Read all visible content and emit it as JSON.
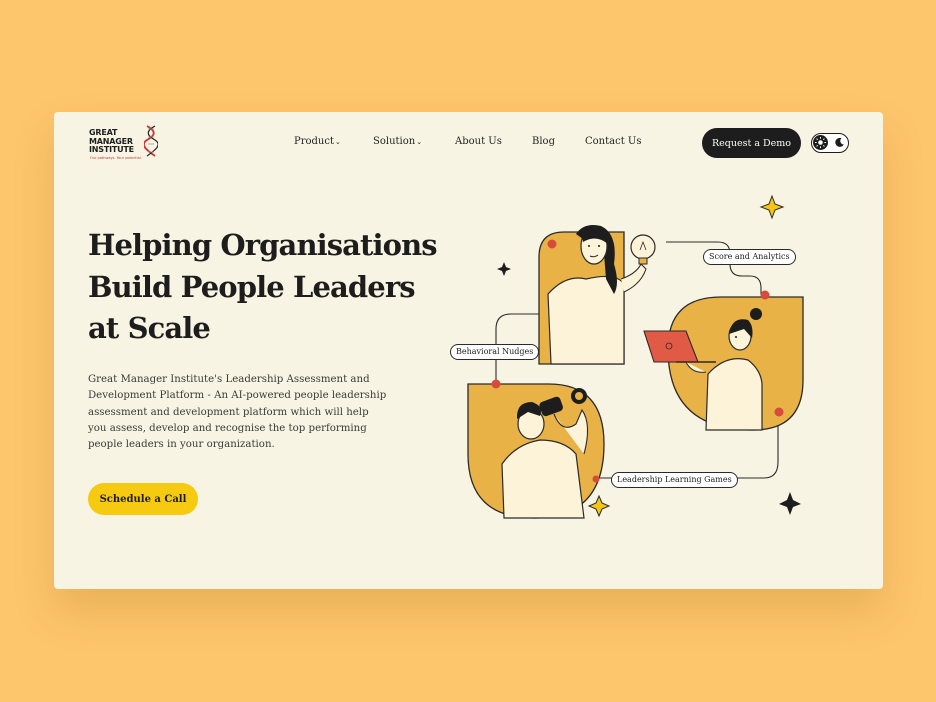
{
  "logo": {
    "line1": "GREAT",
    "line2": "MANAGER",
    "line3": "INSTITUTE",
    "tagline": "Our pathways. Your potential."
  },
  "nav": {
    "product": "Product",
    "solution": "Solution",
    "about": "About Us",
    "blog": "Blog",
    "contact": "Contact Us"
  },
  "header": {
    "demo_button": "Request a Demo",
    "theme_toggle": "light/dark"
  },
  "hero": {
    "title_line1_word1": "Helping",
    "title_line1_word2": " Organisations",
    "title_line2": "Build People Leaders",
    "title_line3": "at Scale",
    "description": "Great Manager Institute's Leadership Assessment and Development Platform - An AI-powered people leadership assessment and development platform which will help you assess, develop and recognise the top performing people leaders in your organization.",
    "cta": "Schedule a Call"
  },
  "illustration": {
    "label_score": "Score and Analytics",
    "label_nudges": "Behavioral Nudges",
    "label_games": "Leadership Learning Games"
  },
  "colors": {
    "page_bg": "#fdc56c",
    "card_bg": "#f8f4e3",
    "accent_yellow": "#f6ca10",
    "mustard": "#e8b247",
    "dark": "#1d1d1d",
    "red_dot": "#d64b3b"
  },
  "icons": [
    "helix-logo-icon",
    "chevron-down-icon",
    "sun-icon",
    "moon-icon",
    "sparkle-icon",
    "lightbulb-icon",
    "laptop-icon",
    "binoculars-icon"
  ]
}
